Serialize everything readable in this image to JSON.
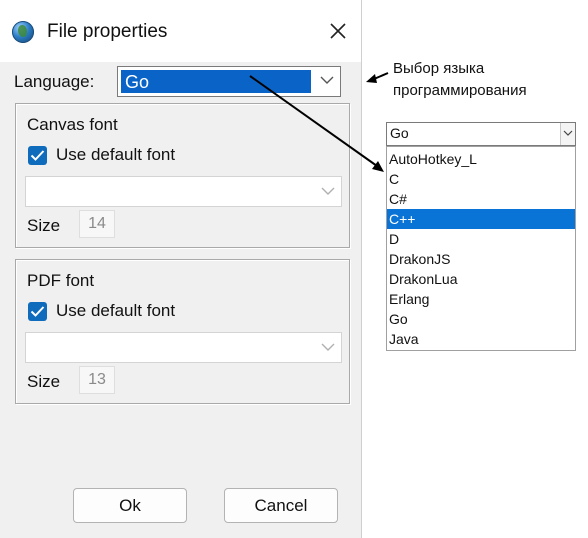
{
  "dialog": {
    "title": "File properties",
    "language_label": "Language:",
    "language_value": "Go",
    "canvas_group": {
      "title": "Canvas font",
      "use_default_label": "Use default font",
      "use_default_checked": true,
      "font_value": "",
      "size_label": "Size",
      "size_value": "14"
    },
    "pdf_group": {
      "title": "PDF font",
      "use_default_label": "Use default font",
      "use_default_checked": true,
      "font_value": "",
      "size_label": "Size",
      "size_value": "13"
    },
    "ok_label": "Ok",
    "cancel_label": "Cancel"
  },
  "annotation": {
    "line1": "Выбор языка",
    "line2": "программирования"
  },
  "dropdown": {
    "value": "Go",
    "items": [
      "AutoHotkey_L",
      "C",
      "C#",
      "C++",
      "D",
      "DrakonJS",
      "DrakonLua",
      "Erlang",
      "Go",
      "Java"
    ],
    "highlighted": "C++"
  },
  "colors": {
    "selection": "#0a64c8",
    "checkbox": "#0f6cbd",
    "dropdown_highlight": "#0a74d6"
  }
}
